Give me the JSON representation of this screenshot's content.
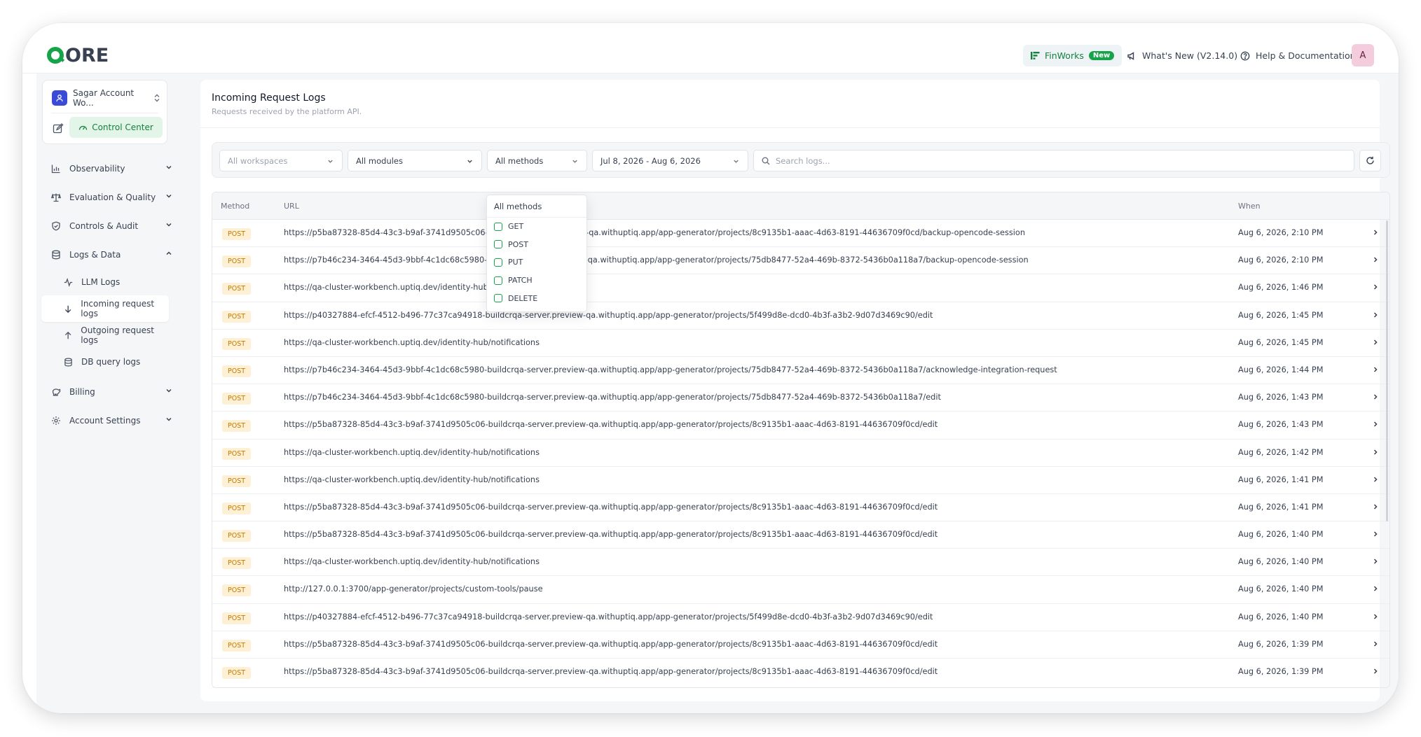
{
  "app": {
    "logo": "QORE"
  },
  "topbar": {
    "finworks_label": "FinWorks",
    "finworks_badge": "New",
    "whats_new": "What's New (V2.14.0)",
    "help": "Help & Documentation",
    "avatar_initial": "A"
  },
  "sidebar": {
    "account_name": "Sagar Account Wo...",
    "control_center": "Control Center",
    "items": [
      {
        "label": "Observability",
        "icon": "bar-chart-icon"
      },
      {
        "label": "Evaluation & Quality",
        "icon": "scale-icon"
      },
      {
        "label": "Controls & Audit",
        "icon": "shield-icon"
      },
      {
        "label": "Logs & Data",
        "icon": "database-icon"
      }
    ],
    "subitems": [
      {
        "label": "LLM Logs",
        "icon": "activity-icon"
      },
      {
        "label": "Incoming request logs",
        "icon": "arrow-down-icon"
      },
      {
        "label": "Outgoing request logs",
        "icon": "arrow-up-icon"
      },
      {
        "label": "DB query logs",
        "icon": "database-icon"
      }
    ],
    "items_after": [
      {
        "label": "Billing",
        "icon": "piggy-bank-icon"
      },
      {
        "label": "Account Settings",
        "icon": "gear-icon"
      }
    ]
  },
  "page": {
    "title": "Incoming Request Logs",
    "subtitle": "Requests received by the platform API."
  },
  "filters": {
    "workspaces": "All workspaces",
    "modules": "All modules",
    "methods": "All methods",
    "date_range": "Jul 8, 2026 - Aug 6, 2026",
    "search_placeholder": "Search logs..."
  },
  "methods_dropdown": {
    "header": "All methods",
    "options": [
      "GET",
      "POST",
      "PUT",
      "PATCH",
      "DELETE"
    ]
  },
  "table": {
    "columns": [
      "Method",
      "URL",
      "When"
    ],
    "rows": [
      {
        "method": "POST",
        "url": "https://p5ba87328-85d4-43c3-b9af-3741d9505c06-buildcrqa-server.preview-qa.withuptiq.app/app-generator/projects/8c9135b1-aaac-4d63-8191-44636709f0cd/backup-opencode-session",
        "when": "Aug 6, 2026, 2:10 PM"
      },
      {
        "method": "POST",
        "url": "https://p7b46c234-3464-45d3-9bbf-4c1dc68c5980-buildcrqa-server.preview-qa.withuptiq.app/app-generator/projects/75db8477-52a4-469b-8372-5436b0a118a7/backup-opencode-session",
        "when": "Aug 6, 2026, 2:10 PM"
      },
      {
        "method": "POST",
        "url": "https://qa-cluster-workbench.uptiq.dev/identity-hub/notifications",
        "when": "Aug 6, 2026, 1:46 PM"
      },
      {
        "method": "POST",
        "url": "https://p40327884-efcf-4512-b496-77c37ca94918-buildcrqa-server.preview-qa.withuptiq.app/app-generator/projects/5f499d8e-dcd0-4b3f-a3b2-9d07d3469c90/edit",
        "when": "Aug 6, 2026, 1:45 PM"
      },
      {
        "method": "POST",
        "url": "https://qa-cluster-workbench.uptiq.dev/identity-hub/notifications",
        "when": "Aug 6, 2026, 1:45 PM"
      },
      {
        "method": "POST",
        "url": "https://p7b46c234-3464-45d3-9bbf-4c1dc68c5980-buildcrqa-server.preview-qa.withuptiq.app/app-generator/projects/75db8477-52a4-469b-8372-5436b0a118a7/acknowledge-integration-request",
        "when": "Aug 6, 2026, 1:44 PM"
      },
      {
        "method": "POST",
        "url": "https://p7b46c234-3464-45d3-9bbf-4c1dc68c5980-buildcrqa-server.preview-qa.withuptiq.app/app-generator/projects/75db8477-52a4-469b-8372-5436b0a118a7/edit",
        "when": "Aug 6, 2026, 1:43 PM"
      },
      {
        "method": "POST",
        "url": "https://p5ba87328-85d4-43c3-b9af-3741d9505c06-buildcrqa-server.preview-qa.withuptiq.app/app-generator/projects/8c9135b1-aaac-4d63-8191-44636709f0cd/edit",
        "when": "Aug 6, 2026, 1:43 PM"
      },
      {
        "method": "POST",
        "url": "https://qa-cluster-workbench.uptiq.dev/identity-hub/notifications",
        "when": "Aug 6, 2026, 1:42 PM"
      },
      {
        "method": "POST",
        "url": "https://qa-cluster-workbench.uptiq.dev/identity-hub/notifications",
        "when": "Aug 6, 2026, 1:41 PM"
      },
      {
        "method": "POST",
        "url": "https://p5ba87328-85d4-43c3-b9af-3741d9505c06-buildcrqa-server.preview-qa.withuptiq.app/app-generator/projects/8c9135b1-aaac-4d63-8191-44636709f0cd/edit",
        "when": "Aug 6, 2026, 1:41 PM"
      },
      {
        "method": "POST",
        "url": "https://p5ba87328-85d4-43c3-b9af-3741d9505c06-buildcrqa-server.preview-qa.withuptiq.app/app-generator/projects/8c9135b1-aaac-4d63-8191-44636709f0cd/edit",
        "when": "Aug 6, 2026, 1:40 PM"
      },
      {
        "method": "POST",
        "url": "https://qa-cluster-workbench.uptiq.dev/identity-hub/notifications",
        "when": "Aug 6, 2026, 1:40 PM"
      },
      {
        "method": "POST",
        "url": "http://127.0.0.1:3700/app-generator/projects/custom-tools/pause",
        "when": "Aug 6, 2026, 1:40 PM"
      },
      {
        "method": "POST",
        "url": "https://p40327884-efcf-4512-b496-77c37ca94918-buildcrqa-server.preview-qa.withuptiq.app/app-generator/projects/5f499d8e-dcd0-4b3f-a3b2-9d07d3469c90/edit",
        "when": "Aug 6, 2026, 1:40 PM"
      },
      {
        "method": "POST",
        "url": "https://p5ba87328-85d4-43c3-b9af-3741d9505c06-buildcrqa-server.preview-qa.withuptiq.app/app-generator/projects/8c9135b1-aaac-4d63-8191-44636709f0cd/edit",
        "when": "Aug 6, 2026, 1:39 PM"
      },
      {
        "method": "POST",
        "url": "https://p5ba87328-85d4-43c3-b9af-3741d9505c06-buildcrqa-server.preview-qa.withuptiq.app/app-generator/projects/8c9135b1-aaac-4d63-8191-44636709f0cd/edit",
        "when": "Aug 6, 2026, 1:39 PM"
      }
    ]
  },
  "colors": {
    "brand_green": "#16a34a",
    "post_badge_bg": "#fdf0d4",
    "post_badge_text": "#c27a00",
    "sidebar_bg": "#f5f6f8"
  }
}
